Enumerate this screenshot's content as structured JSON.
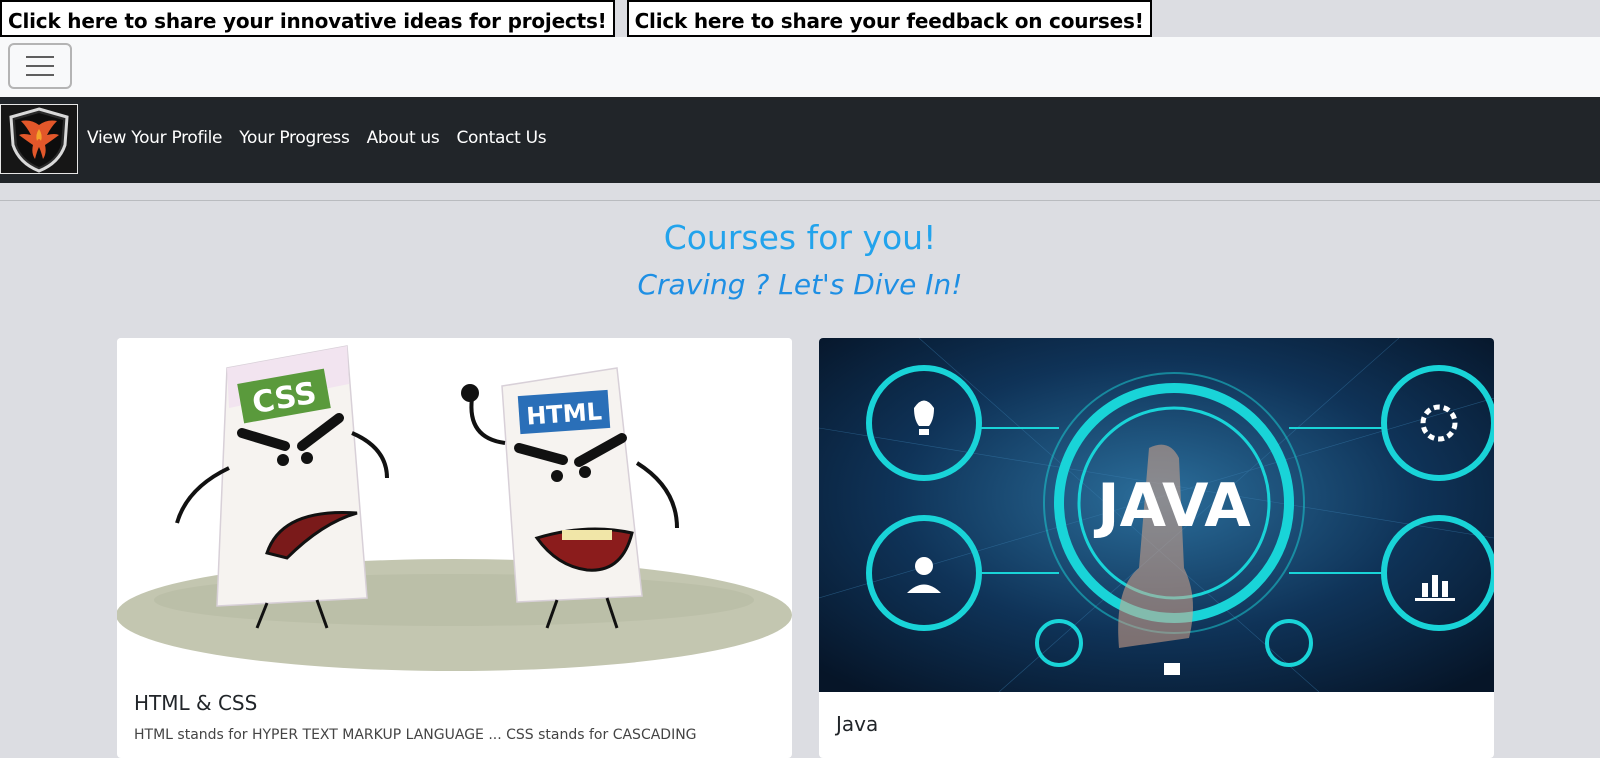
{
  "top_buttons": {
    "ideas_label": "Click here to share your innovative ideas for projects!",
    "feedback_label": "Click here to share your feedback on courses!"
  },
  "nav": {
    "links": [
      "View Your Profile",
      "Your Progress",
      "About us",
      "Contact Us"
    ]
  },
  "hero": {
    "title": "Courses for you!",
    "subtitle": "Craving ? Let's Dive In!"
  },
  "cards": [
    {
      "title": "HTML & CSS",
      "image_labels": [
        "CSS",
        "HTML"
      ],
      "text": "HTML stands for HYPER TEXT MARKUP LANGUAGE ... CSS stands for CASCADING"
    },
    {
      "title": "Java",
      "image_labels": [
        "JAVA"
      ]
    }
  ],
  "colors": {
    "page_bg": "#dcdde2",
    "navbar_bg": "#212529",
    "heading_blue": "#22a3ec",
    "subheading_blue": "#1e8fe4"
  }
}
